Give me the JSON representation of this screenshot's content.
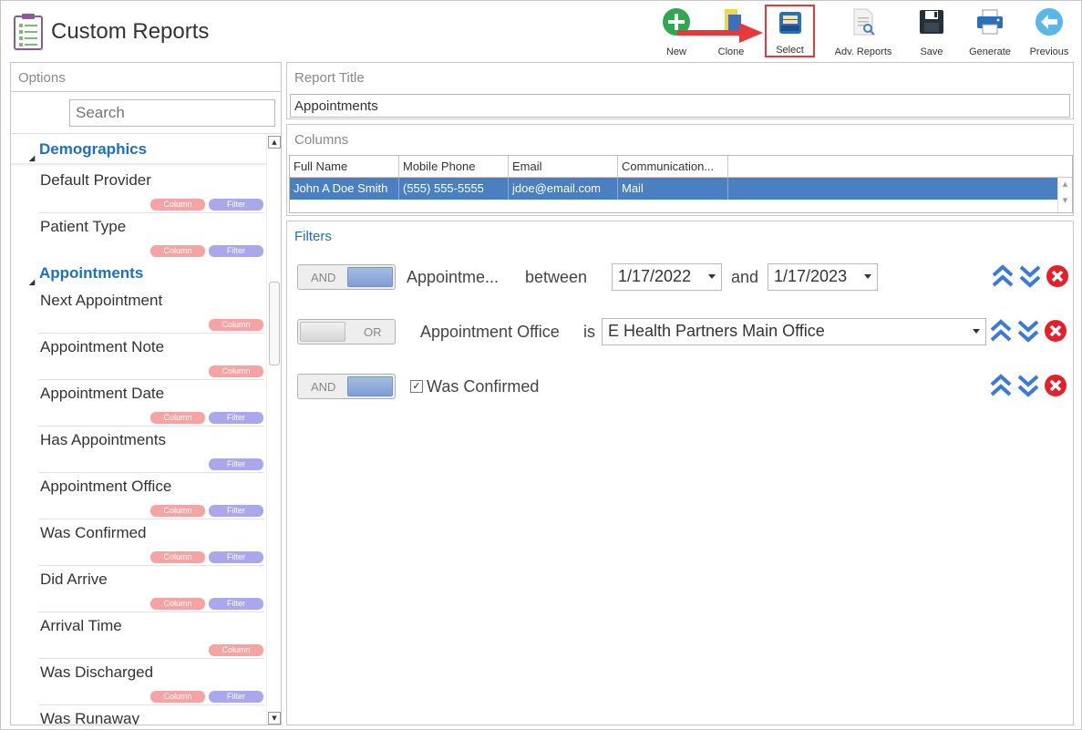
{
  "app": {
    "title": "Custom Reports"
  },
  "toolbar": {
    "new_label": "New",
    "clone_label": "Clone",
    "select_label": "Select",
    "adv_reports_label": "Adv. Reports",
    "save_label": "Save",
    "generate_label": "Generate",
    "previous_label": "Previous"
  },
  "options_panel": {
    "header": "Options",
    "search_placeholder": "Search",
    "groups": [
      {
        "name": "Demographics",
        "items": [
          {
            "label": "Default Provider",
            "badges": [
              "Column",
              "Filter"
            ]
          },
          {
            "label": "Patient Type",
            "badges": [
              "Column",
              "Filter"
            ]
          }
        ]
      },
      {
        "name": "Appointments",
        "items": [
          {
            "label": "Next Appointment",
            "badges": [
              "Column"
            ]
          },
          {
            "label": "Appointment Note",
            "badges": [
              "Column"
            ]
          },
          {
            "label": "Appointment Date",
            "badges": [
              "Column",
              "Filter"
            ]
          },
          {
            "label": "Has Appointments",
            "badges": [
              "Filter"
            ]
          },
          {
            "label": "Appointment Office",
            "badges": [
              "Column",
              "Filter"
            ]
          },
          {
            "label": "Was Confirmed",
            "badges": [
              "Column",
              "Filter"
            ]
          },
          {
            "label": "Did Arrive",
            "badges": [
              "Column",
              "Filter"
            ]
          },
          {
            "label": "Arrival Time",
            "badges": [
              "Column"
            ]
          },
          {
            "label": "Was Discharged",
            "badges": [
              "Column",
              "Filter"
            ]
          },
          {
            "label": "Was Runaway",
            "badges": []
          }
        ]
      }
    ],
    "badge_column": "Column",
    "badge_filter": "Filter"
  },
  "report_title_panel": {
    "header": "Report Title",
    "value": "Appointments"
  },
  "columns_panel": {
    "header": "Columns",
    "headers": [
      "Full Name",
      "Mobile Phone",
      "Email",
      "Communication..."
    ],
    "row": [
      "John A Doe Smith",
      "(555) 555-5555",
      "jdoe@email.com",
      "Mail"
    ]
  },
  "filters_panel": {
    "header": "Filters",
    "filters": [
      {
        "logic": "AND",
        "field": "Appointme...",
        "operator": "between",
        "value1": "1/17/2022",
        "joiner": "and",
        "value2": "1/17/2023"
      },
      {
        "logic": "OR",
        "field": "Appointment Office",
        "operator": "is",
        "value1": "E Health Partners Main Office"
      },
      {
        "logic": "AND",
        "checked": true,
        "field": "Was Confirmed"
      }
    ]
  },
  "colors": {
    "accent_blue": "#1f6fbf",
    "selected_row": "#4a7fc1",
    "badge_column": "#f5a3a3",
    "badge_filter": "#a9a8ec",
    "highlight_red": "#e5393c"
  }
}
